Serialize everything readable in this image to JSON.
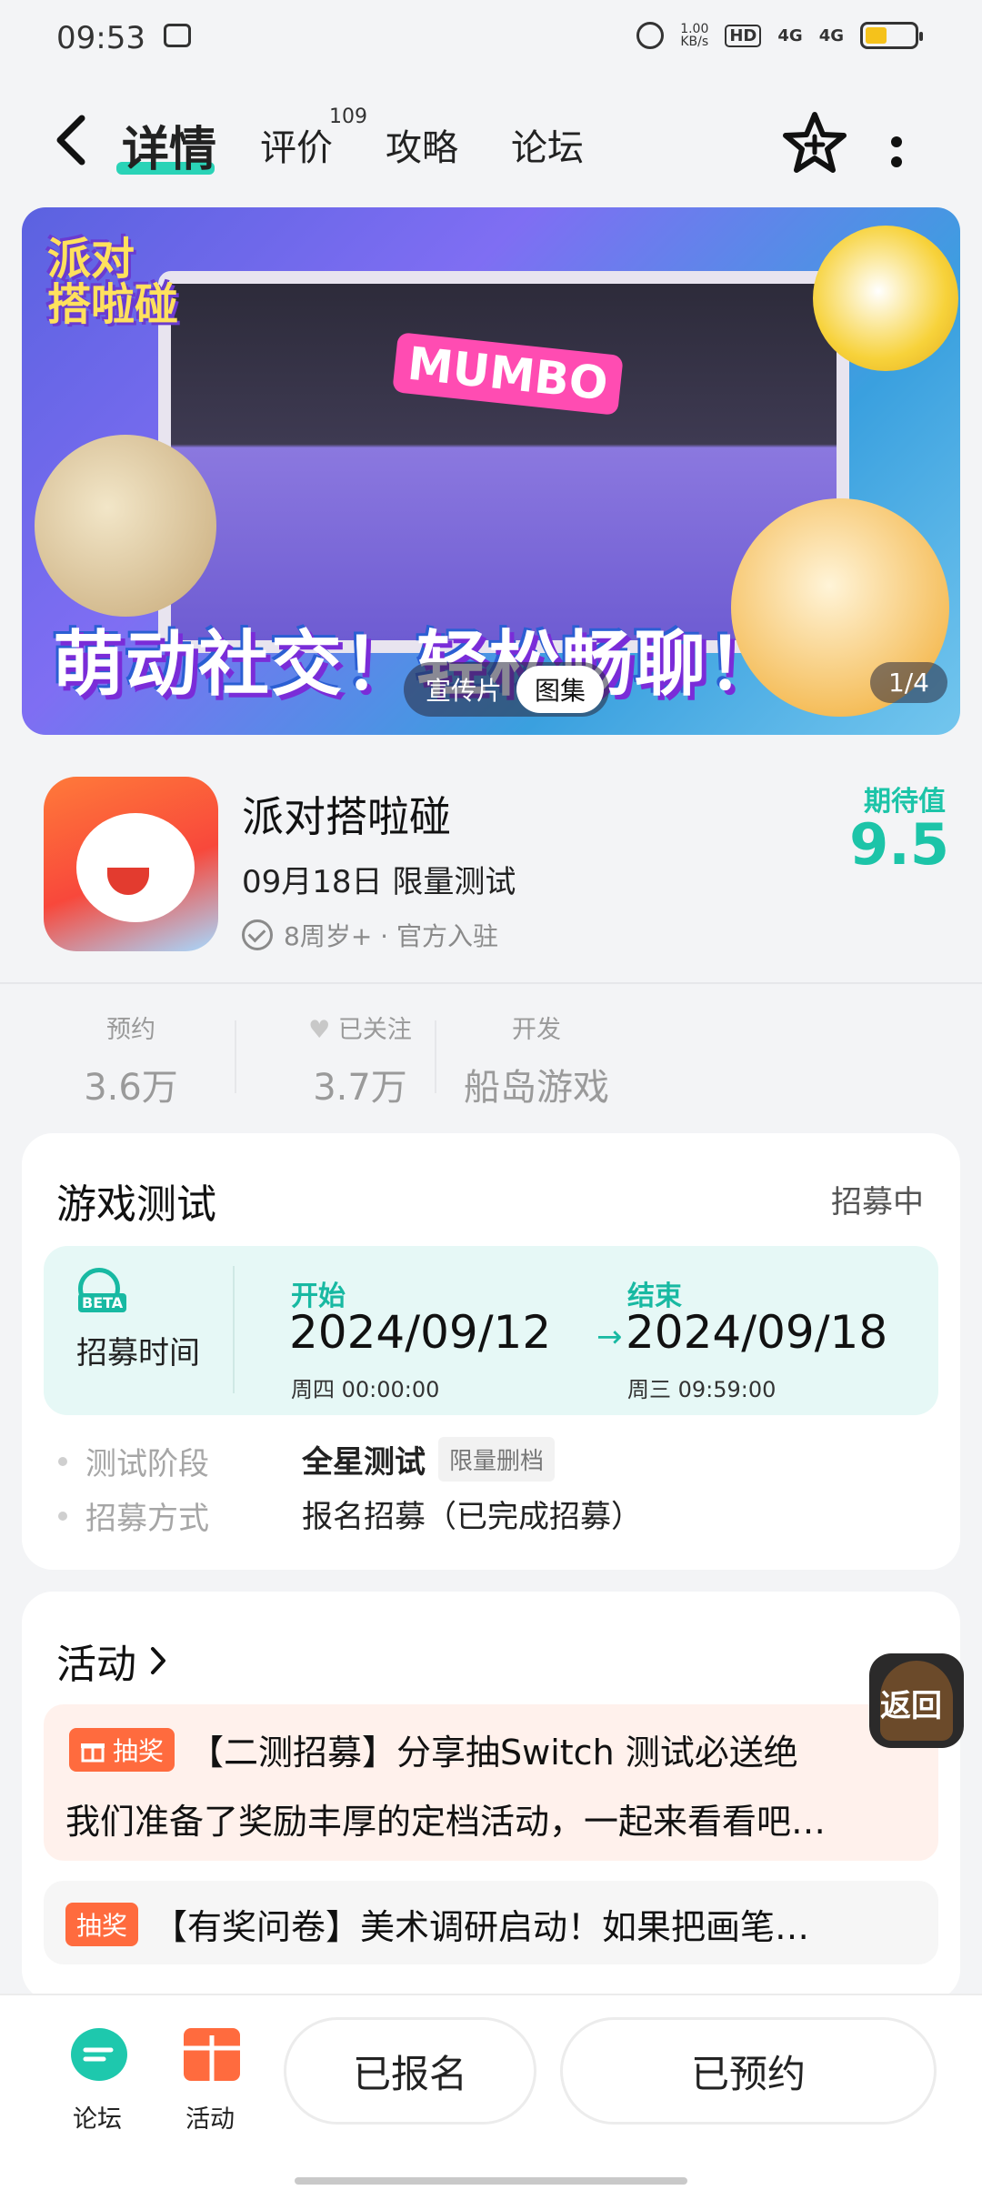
{
  "status_bar": {
    "time": "09:53",
    "net_speed": "1.00\nKB/s",
    "hd": "HD",
    "signal1": "4G",
    "signal2": "4G",
    "battery_level": 0.45
  },
  "nav": {
    "tabs": [
      {
        "label": "详情",
        "active": true
      },
      {
        "label": "评价",
        "badge": "109"
      },
      {
        "label": "攻略"
      },
      {
        "label": "论坛"
      }
    ]
  },
  "banner": {
    "logo_text": "派对\n搭啦碰",
    "marquee": "MUMBO",
    "slogan": "萌动社交！轻松畅聊！",
    "pills": [
      "宣传片",
      "图集"
    ],
    "active_pill": "图集",
    "counter": "1/4"
  },
  "app": {
    "name": "派对搭啦碰",
    "date_line": "09月18日 限量测试",
    "meta": "8周岁+ · 官方入驻",
    "rating_label": "期待值",
    "rating_value": "9.5"
  },
  "stats": [
    {
      "label": "预约",
      "value": "3.6万"
    },
    {
      "label": "已关注",
      "value": "3.7万"
    },
    {
      "label": "开发",
      "value": "船岛游戏"
    }
  ],
  "test_card": {
    "title": "游戏测试",
    "status": "招募中",
    "recruit_label": "招募时间",
    "beta_tag": "BETA",
    "start": {
      "head": "开始",
      "date": "2024/09/12",
      "sub": "周四  00:00:00"
    },
    "end": {
      "head": "结束",
      "date": "2024/09/18",
      "sub": "周三  09:59:00"
    },
    "rows": [
      {
        "label": "测试阶段",
        "value": "全星测试",
        "tag": "限量删档"
      },
      {
        "label": "招募方式",
        "value": "报名招募（已完成招募）"
      }
    ]
  },
  "activity_card": {
    "title": "活动",
    "items": [
      {
        "tag": "抽奖",
        "title": "【二测招募】分享抽Switch 测试必送绝",
        "desc": "我们准备了奖励丰厚的定档活动，一起来看看吧…"
      },
      {
        "tag": "抽奖",
        "title": "【有奖问卷】美术调研启动！如果把画笔…"
      }
    ]
  },
  "float_back": {
    "label": "返回"
  },
  "bottom_bar": {
    "forum_label": "论坛",
    "activity_label": "活动",
    "registered_label": "已报名",
    "reserved_label": "已预约"
  },
  "colors": {
    "accent": "#1cc4a8",
    "tag_orange": "#ff6b3e",
    "tab_underline": "#2ad3b7"
  }
}
